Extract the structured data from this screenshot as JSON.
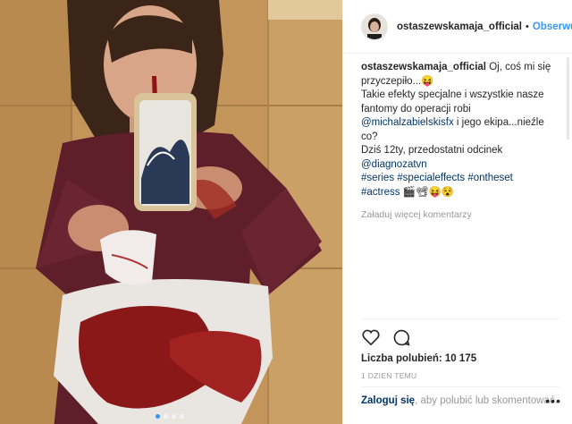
{
  "header": {
    "username": "ostaszewskamaja_official",
    "separator": "•",
    "follow_label": "Obserwuj"
  },
  "caption": {
    "username": "ostaszewskamaja_official",
    "text_1": "Oj, coś mi się przyczepiło...",
    "emoji_1": "😝",
    "text_2": "Takie efekty specjalne i wszystkie nasze fantomy do operacji robi",
    "mention_1": "@michalzabielskisfx",
    "text_3": "i jego ekipa...nieźle co?",
    "text_4": "Dziś 12ty, przedostatni odcinek",
    "mention_2": "@diagnozatvn",
    "tag_1": "#series",
    "tag_2": "#specialeffects",
    "tag_3": "#ontheset",
    "tag_4": "#actress",
    "emoji_2": "🎬📽😝😵"
  },
  "load_more_label": "Załaduj więcej komentarzy",
  "actions": {
    "like_icon": "heart-icon",
    "comment_icon": "speech-bubble-icon"
  },
  "likes_label": "Liczba polubień: 10 175",
  "time_label": "1 DZIEŃ TEMU",
  "login": {
    "link": "Zaloguj się",
    "rest": ", aby polubić lub skomentować.",
    "more_icon": "more-dots-icon"
  },
  "colors": {
    "accent": "#3897f0",
    "link": "#003569",
    "muted": "#999999",
    "border": "#efefef"
  },
  "carousel": {
    "dots": 4,
    "active_index": 0
  }
}
